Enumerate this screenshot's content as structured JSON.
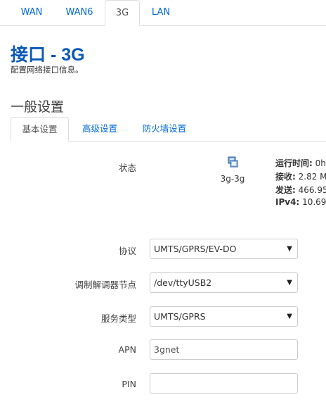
{
  "top_tabs": [
    "WAN",
    "WAN6",
    "3G",
    "LAN"
  ],
  "active_top_tab": "3G",
  "page": {
    "title": "接口 - 3G",
    "description": "配置网络接口信息。"
  },
  "section_title": "一般设置",
  "sub_tabs": [
    "基本设置",
    "高级设置",
    "防火墙设置"
  ],
  "active_sub_tab": "基本设置",
  "status": {
    "label": "状态",
    "icon": "network-interface-icon",
    "interface_name": "3g-3g",
    "uptime_label": "运行时间:",
    "uptime_value": "0h",
    "rx_label": "接收:",
    "rx_value": "2.82 M",
    "tx_label": "发送:",
    "tx_value": "466.95",
    "ipv4_label": "IPv4:",
    "ipv4_value": "10.69."
  },
  "form": {
    "protocol_label": "协议",
    "protocol_value": "UMTS/GPRS/EV-DO",
    "modem_label": "调制解调器节点",
    "modem_value": "/dev/ttyUSB2",
    "service_label": "服务类型",
    "service_value": "UMTS/GPRS",
    "apn_label": "APN",
    "apn_value": "3gnet",
    "pin_label": "PIN",
    "pin_value": ""
  },
  "colors": {
    "link": "#0069d6",
    "title": "#0a58b8",
    "border": "#dddddd"
  }
}
